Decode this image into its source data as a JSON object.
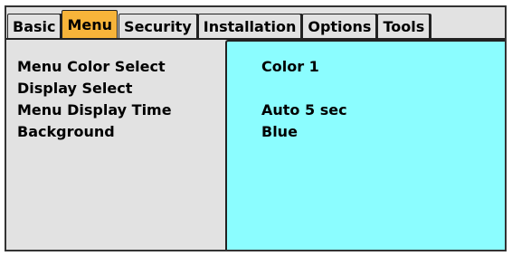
{
  "tabs": [
    {
      "label": "Basic",
      "active": false
    },
    {
      "label": "Menu",
      "active": true
    },
    {
      "label": "Security",
      "active": false
    },
    {
      "label": "Installation",
      "active": false
    },
    {
      "label": "Options",
      "active": false
    },
    {
      "label": "Tools",
      "active": false
    }
  ],
  "settings": [
    {
      "label": "Menu Color Select",
      "value": "Color 1"
    },
    {
      "label": "Display Select",
      "value": ""
    },
    {
      "label": "Menu Display Time",
      "value": "Auto  5 sec"
    },
    {
      "label": "Background",
      "value": "Blue"
    }
  ],
  "colors": {
    "active_tab": "#f7b43a",
    "value_panel": "#8bfdff",
    "window_bg": "#e2e2e2"
  }
}
